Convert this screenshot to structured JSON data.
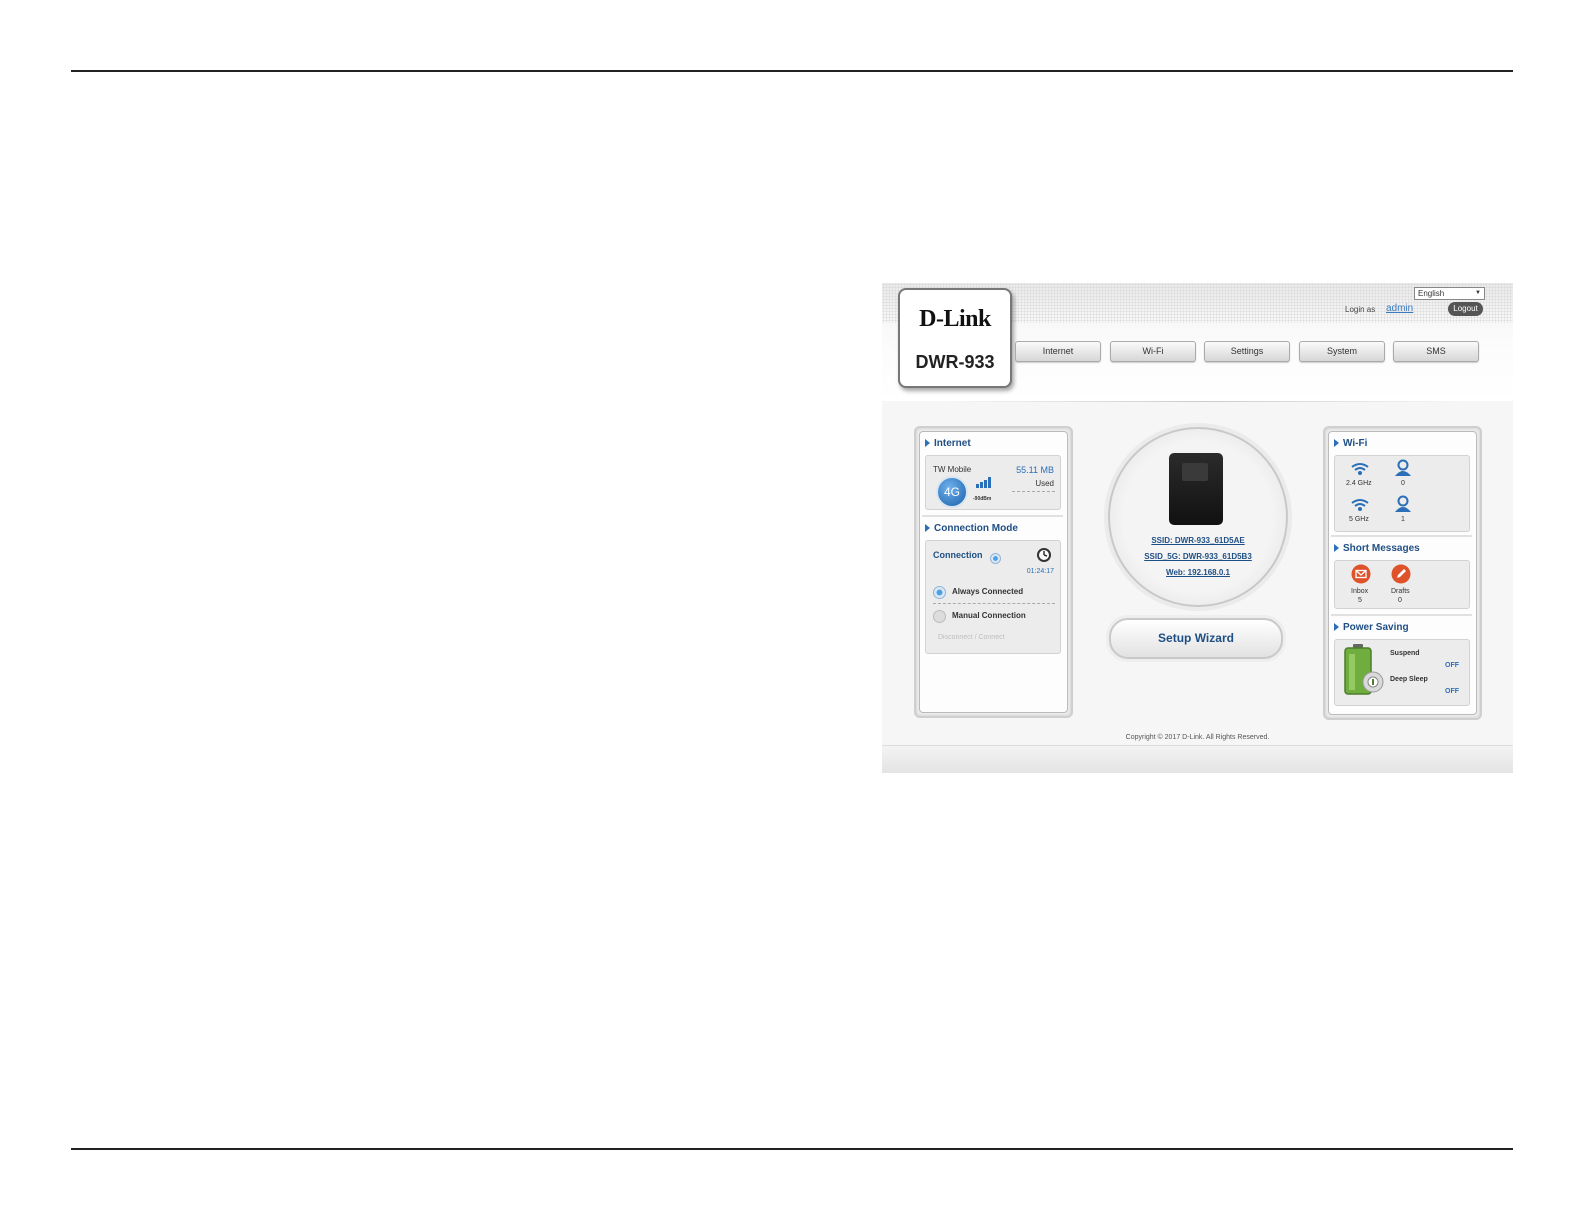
{
  "header": {
    "brand": "D-Link",
    "model": "DWR-933",
    "language": "English",
    "login_as": "Login as",
    "user": "admin",
    "logout": "Logout"
  },
  "nav": [
    "Internet",
    "Wi-Fi",
    "Settings",
    "System",
    "SMS"
  ],
  "internet": {
    "title": "Internet",
    "carrier": "TW Mobile",
    "network_type": "4G",
    "signal_level": "-90dBm",
    "data_used_value": "55.11 MB",
    "data_used_label": "Used"
  },
  "connection_mode": {
    "title": "Connection Mode",
    "connection_label": "Connection",
    "timer": "01:24:17",
    "options": [
      "Always Connected",
      "Manual Connection"
    ],
    "selected": "Always Connected",
    "disconnect_connect": "Disconnect / Connect"
  },
  "device": {
    "ssid": "SSID: DWR-933_61D5AE",
    "ssid_5g": "SSID_5G: DWR-933_61D5B3",
    "web": "Web: 192.168.0.1",
    "setup_wizard": "Setup Wizard"
  },
  "wifi": {
    "title": "Wi-Fi",
    "bands": [
      {
        "band": "2.4 GHz",
        "clients": "0"
      },
      {
        "band": "5 GHz",
        "clients": "1"
      }
    ]
  },
  "short_messages": {
    "title": "Short Messages",
    "inbox_label": "Inbox",
    "inbox_count": "5",
    "drafts_label": "Drafts",
    "drafts_count": "0"
  },
  "power_saving": {
    "title": "Power Saving",
    "suspend_label": "Suspend",
    "suspend_value": "OFF",
    "deep_sleep_label": "Deep Sleep",
    "deep_sleep_value": "OFF"
  },
  "footer": {
    "copyright": "Copyright © 2017 D-Link. All Rights Reserved."
  },
  "colors": {
    "accent_blue": "#2a6fb8",
    "title_blue": "#1f4f84",
    "message_orange": "#e0532a"
  }
}
